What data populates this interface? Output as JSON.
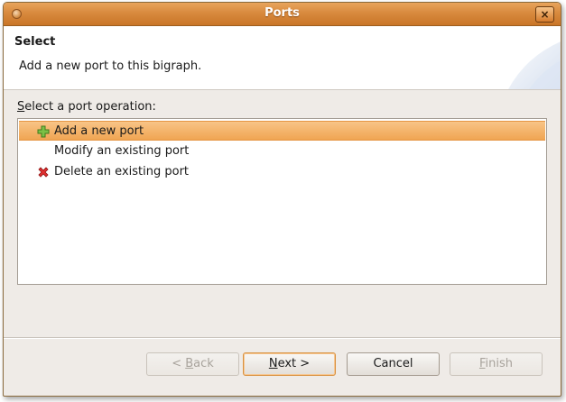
{
  "window": {
    "title": "Ports",
    "close_label": "×"
  },
  "header": {
    "title": "Select",
    "description": "Add a new port to this bigraph."
  },
  "prompt": {
    "mnemonic": "S",
    "rest": "elect a port operation:"
  },
  "operations": [
    {
      "label": "Add a new port",
      "icon": "green-plus-icon",
      "selected": true
    },
    {
      "label": "Modify an existing port",
      "icon": "",
      "selected": false
    },
    {
      "label": "Delete an existing port",
      "icon": "red-x-icon",
      "selected": false
    }
  ],
  "buttons": {
    "back": {
      "prefix": "< ",
      "mnemonic": "B",
      "rest": "ack",
      "enabled": false
    },
    "next": {
      "mnemonic": "N",
      "rest": "ext >",
      "enabled": true
    },
    "cancel": {
      "label": "Cancel",
      "enabled": true
    },
    "finish": {
      "mnemonic": "F",
      "rest": "inish",
      "enabled": false
    }
  },
  "colors": {
    "titlebar": "#d88a3e",
    "selection": "#f0a552",
    "add_icon": "#5aa02c",
    "delete_icon": "#d42020"
  }
}
